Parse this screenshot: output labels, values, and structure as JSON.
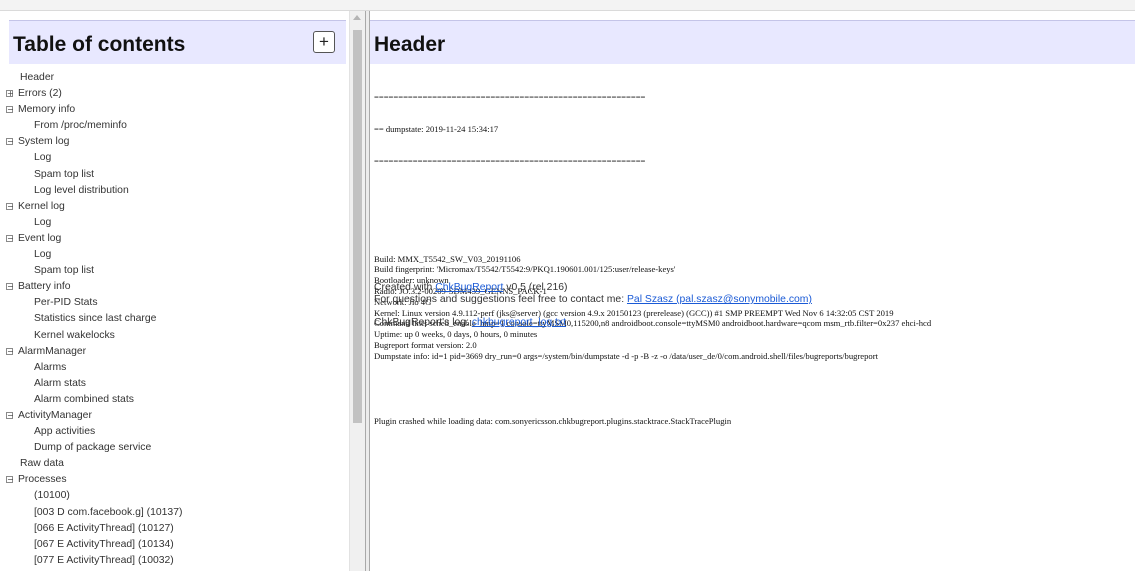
{
  "toc": {
    "title": "Table of contents",
    "add_button": "+",
    "items": [
      {
        "label": "Header",
        "level": 0,
        "expander": ""
      },
      {
        "label": "Errors (2)",
        "level": 0,
        "expander": "+"
      },
      {
        "label": "Memory info",
        "level": 0,
        "expander": "−"
      },
      {
        "label": "From /proc/meminfo",
        "level": 1,
        "expander": ""
      },
      {
        "label": "System log",
        "level": 0,
        "expander": "−"
      },
      {
        "label": "Log",
        "level": 1,
        "expander": ""
      },
      {
        "label": "Spam top list",
        "level": 1,
        "expander": ""
      },
      {
        "label": "Log level distribution",
        "level": 1,
        "expander": ""
      },
      {
        "label": "Kernel log",
        "level": 0,
        "expander": "−"
      },
      {
        "label": "Log",
        "level": 1,
        "expander": ""
      },
      {
        "label": "Event log",
        "level": 0,
        "expander": "−"
      },
      {
        "label": "Log",
        "level": 1,
        "expander": ""
      },
      {
        "label": "Spam top list",
        "level": 1,
        "expander": ""
      },
      {
        "label": "Battery info",
        "level": 0,
        "expander": "−"
      },
      {
        "label": "Per-PID Stats",
        "level": 1,
        "expander": ""
      },
      {
        "label": "Statistics since last charge",
        "level": 1,
        "expander": ""
      },
      {
        "label": "Kernel wakelocks",
        "level": 1,
        "expander": ""
      },
      {
        "label": "AlarmManager",
        "level": 0,
        "expander": "−"
      },
      {
        "label": "Alarms",
        "level": 1,
        "expander": ""
      },
      {
        "label": "Alarm stats",
        "level": 1,
        "expander": ""
      },
      {
        "label": "Alarm combined stats",
        "level": 1,
        "expander": ""
      },
      {
        "label": "ActivityManager",
        "level": 0,
        "expander": "−"
      },
      {
        "label": "App activities",
        "level": 1,
        "expander": ""
      },
      {
        "label": "Dump of package service",
        "level": 1,
        "expander": ""
      },
      {
        "label": "Raw data",
        "level": 0,
        "expander": ""
      },
      {
        "label": "Processes",
        "level": 0,
        "expander": "−"
      },
      {
        "label": "(10100)",
        "level": 1,
        "expander": ""
      },
      {
        "label": "[003 D com.facebook.g] (10137)",
        "level": 1,
        "expander": ""
      },
      {
        "label": "[066 E ActivityThread] (10127)",
        "level": 1,
        "expander": ""
      },
      {
        "label": "[067 E ActivityThread] (10134)",
        "level": 1,
        "expander": ""
      },
      {
        "label": "[077 E ActivityThread] (10032)",
        "level": 1,
        "expander": ""
      }
    ]
  },
  "main": {
    "title": "Header",
    "separator": "========================================================",
    "dumpstate_line": "== dumpstate: 2019-11-24 15:34:17",
    "build_lines": [
      "Build: MMX_T5542_SW_V03_20191106",
      "Build fingerprint: 'Micromax/T5542/T5542:9/PKQ1.190601.001/125:user/release-keys'",
      "Bootloader: unknown",
      "Radio: JO.3.2-00209-SDM439_GENNS_PACK-1",
      "Network: Jio 4G",
      "Kernel: Linux version 4.9.112-perf (jks@server) (gcc version 4.9.x 20150123 (prerelease) (GCC)) #1 SMP PREEMPT Wed Nov 6 14:32:05 CST 2019",
      "Command line: sched_enable_hmp=1 console=ttyMSM0,115200,n8 androidboot.console=ttyMSM0 androidboot.hardware=qcom msm_rtb.filter=0x237 ehci-hcd",
      "Uptime: up 0 weeks, 0 days, 0 hours, 0 minutes",
      "Bugreport format version: 2.0",
      "Dumpstate info: id=1 pid=3669 dry_run=0 args=/system/bin/dumpstate -d -p -B -z -o /data/user_de/0/com.android.shell/files/bugreports/bugreport"
    ],
    "plugin_crash": "Plugin crashed while loading data: com.sonyericsson.chkbugreport.plugins.stacktrace.StackTracePlugin",
    "created_prefix": "Created with ",
    "created_link": "ChkBugReport",
    "created_suffix": " v0.5 (rel 216)",
    "contact_prefix": "For questions and suggestions feel free to contact me: ",
    "contact_link": "Pal Szasz (pal.szasz@sonymobile.com)",
    "log_prefix": "ChkBugReport's log: ",
    "log_link": "chkbugreport_log.txt"
  },
  "colors": {
    "header_bg": "#e8e8ff",
    "link": "#1a5ad6"
  }
}
